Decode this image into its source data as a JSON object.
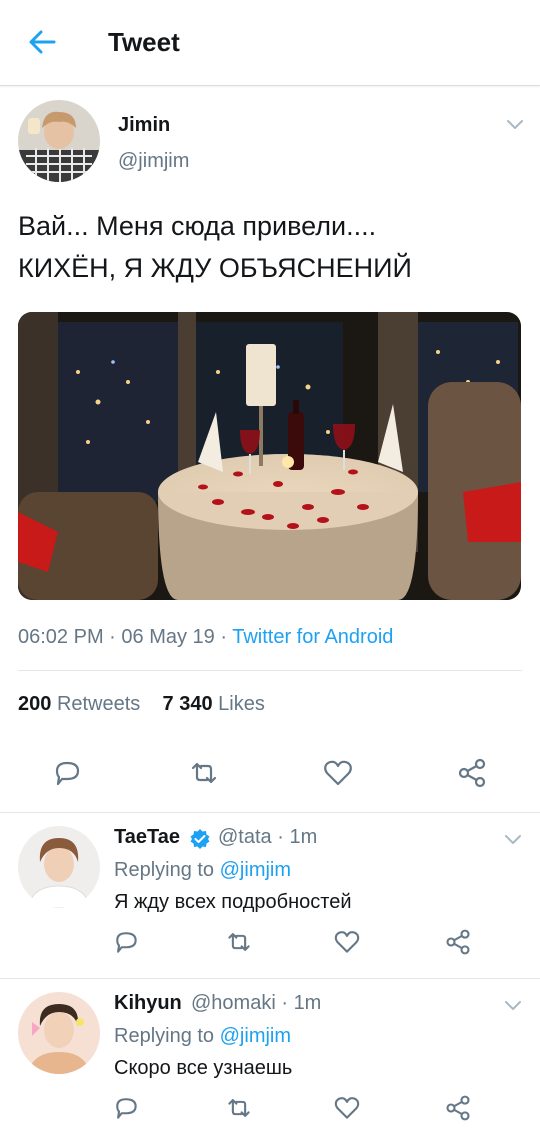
{
  "header": {
    "title": "Tweet"
  },
  "tweet": {
    "author_name": "Jimin",
    "author_handle": "@jimjim",
    "text_line1": "Вай... Меня сюда привели....",
    "text_line2": "КИХЁН, Я ЖДУ ОБЪЯСНЕНИЙ",
    "time": "06:02 PM",
    "date": "06 May 19",
    "source": "Twitter for Android",
    "retweets_count": "200",
    "retweets_label": "Retweets",
    "likes_count": "7 340",
    "likes_label": "Likes"
  },
  "replies": [
    {
      "name": "TaeTae",
      "verified": true,
      "handle": "@tata",
      "time": "1m",
      "replying_label": "Replying to",
      "replying_to": "@jimjim",
      "text": "Я жду всех подробностей"
    },
    {
      "name": "Kihyun",
      "verified": false,
      "handle": "@homaki",
      "time": "1m",
      "replying_label": "Replying to",
      "replying_to": "@jimjim",
      "text": "Скоро все узнаешь"
    }
  ],
  "colors": {
    "accent": "#1da1f2",
    "secondary_text": "#657786",
    "icon": "#657786"
  }
}
